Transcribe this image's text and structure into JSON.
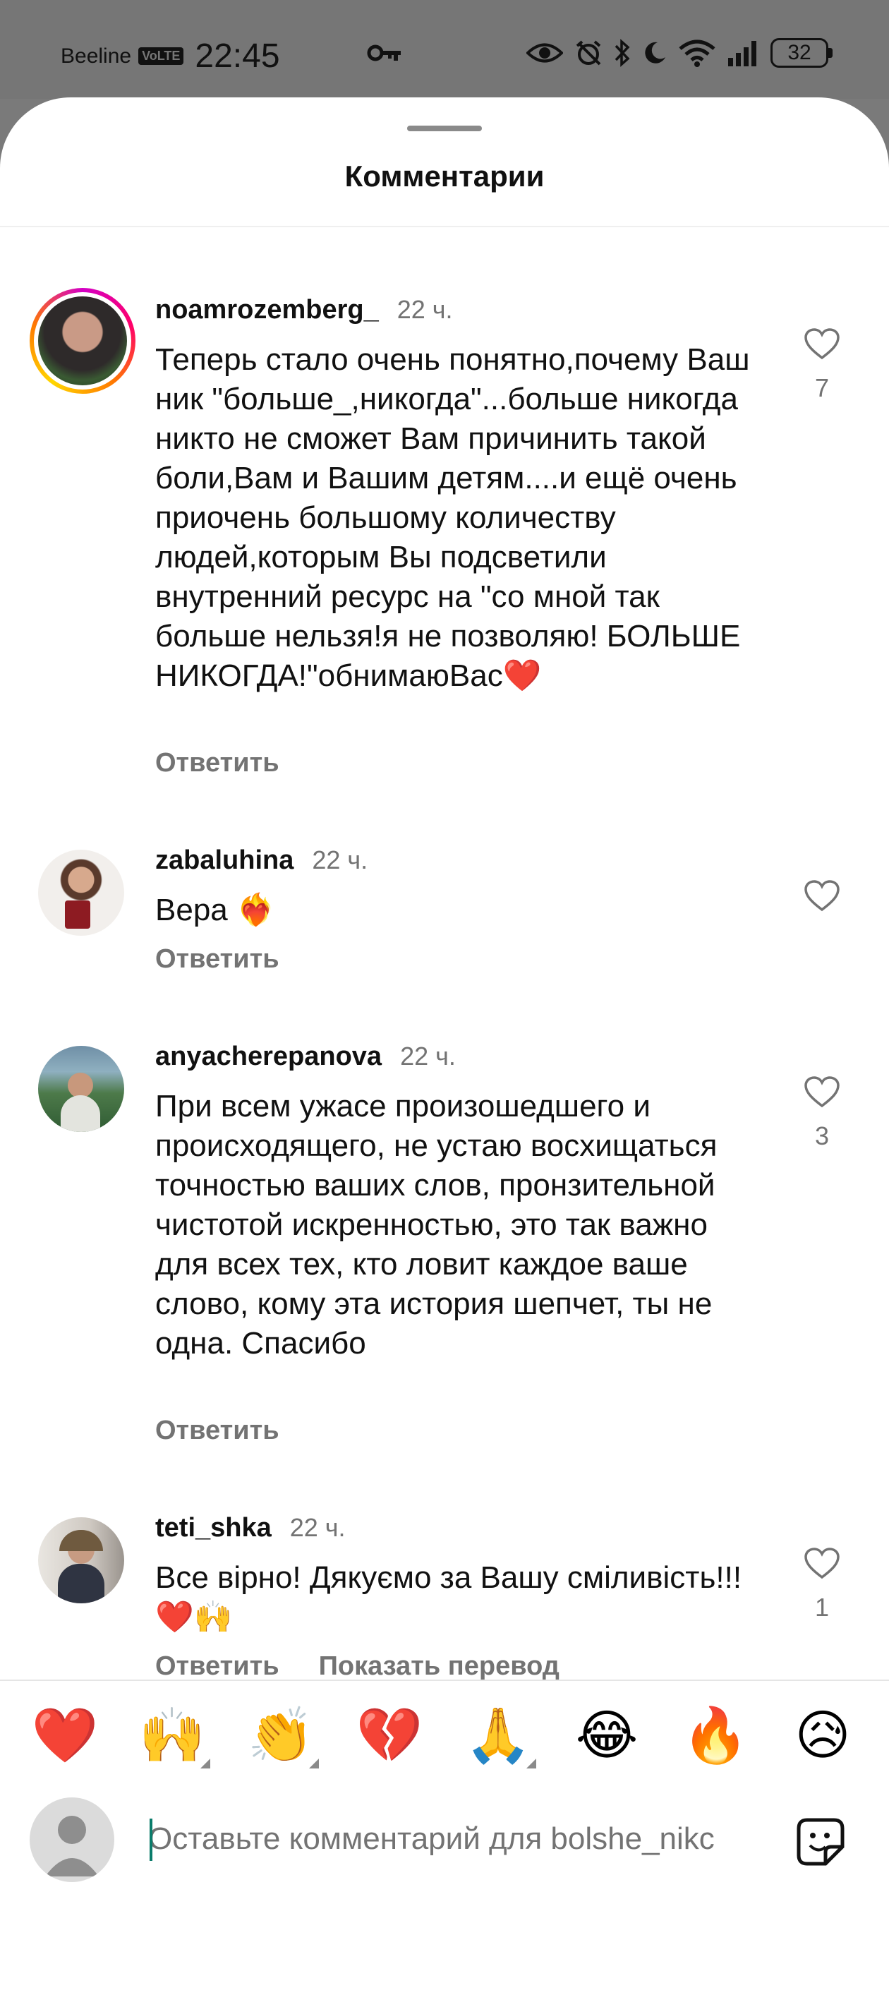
{
  "status_bar": {
    "carrier": "Beeline",
    "network_badge": "VoLTE",
    "time": "22:45",
    "battery": "32"
  },
  "sheet": {
    "title": "Комментарии"
  },
  "comments": [
    {
      "username": "noamrozemberg_",
      "time": "22 ч.",
      "text": "Теперь стало очень понятно,почему Ваш ник \"больше_,никогда\"...больше никогда никто не сможет Вам причинить такой боли,Вам и Вашим детям....и ещё очень приочень большому количеству людей,которым Вы подсветили внутренний ресурс на \"со мной так больше нельзя!я не позволяю! БОЛЬШЕ НИКОГДА!\"обнимаюВас❤️",
      "reply": "Ответить",
      "likes": "7"
    },
    {
      "username": "zabaluhina",
      "time": "22 ч.",
      "text": "Вера ❤️‍🔥",
      "reply": "Ответить",
      "likes": ""
    },
    {
      "username": "anyacherepanova",
      "time": "22 ч.",
      "text": "При всем ужасе произошедшего и происходящего, не устаю восхищаться точностью ваших слов, пронзительной чистотой искренностью, это так важно для всех тех, кто ловит каждое ваше слово, кому эта история шепчет, ты не одна. Спасибо",
      "reply": "Ответить",
      "likes": "3"
    },
    {
      "username": "teti_shka",
      "time": "22 ч.",
      "text": "Все вірно! Дякуємо за Вашу сміливість!!! ❤️🙌",
      "reply": "Ответить",
      "translate": "Показать перевод",
      "likes": "1"
    }
  ],
  "quick_reactions": [
    "❤️",
    "🙌",
    "👏",
    "💔",
    "🙏",
    "😂",
    "🔥",
    "😥"
  ],
  "composer": {
    "placeholder": "Оставьте комментарий для bolshe_nikc"
  }
}
